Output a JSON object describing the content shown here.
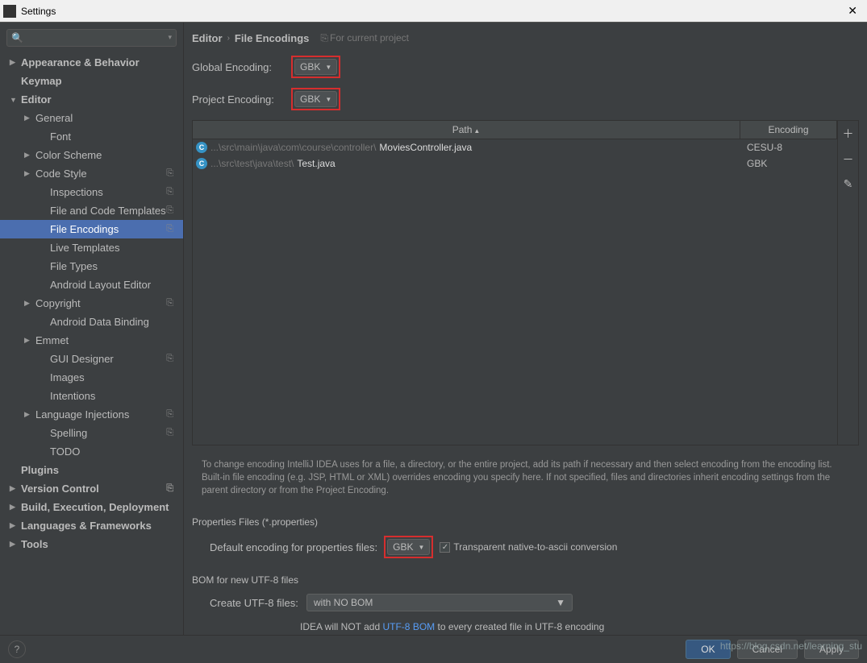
{
  "window": {
    "title": "Settings"
  },
  "search": {
    "placeholder": ""
  },
  "sidebar": {
    "items": [
      {
        "label": "Appearance & Behavior",
        "indent": 0,
        "arrow": "▶",
        "bold": true
      },
      {
        "label": "Keymap",
        "indent": 0,
        "arrow": "",
        "bold": true
      },
      {
        "label": "Editor",
        "indent": 0,
        "arrow": "▼",
        "bold": true
      },
      {
        "label": "General",
        "indent": 1,
        "arrow": "▶"
      },
      {
        "label": "Font",
        "indent": 2,
        "arrow": ""
      },
      {
        "label": "Color Scheme",
        "indent": 1,
        "arrow": "▶"
      },
      {
        "label": "Code Style",
        "indent": 1,
        "arrow": "▶",
        "copy": true
      },
      {
        "label": "Inspections",
        "indent": 2,
        "arrow": "",
        "copy": true
      },
      {
        "label": "File and Code Templates",
        "indent": 2,
        "arrow": "",
        "copy": true
      },
      {
        "label": "File Encodings",
        "indent": 2,
        "arrow": "",
        "copy": true,
        "selected": true
      },
      {
        "label": "Live Templates",
        "indent": 2,
        "arrow": ""
      },
      {
        "label": "File Types",
        "indent": 2,
        "arrow": ""
      },
      {
        "label": "Android Layout Editor",
        "indent": 2,
        "arrow": ""
      },
      {
        "label": "Copyright",
        "indent": 1,
        "arrow": "▶",
        "copy": true
      },
      {
        "label": "Android Data Binding",
        "indent": 2,
        "arrow": ""
      },
      {
        "label": "Emmet",
        "indent": 1,
        "arrow": "▶"
      },
      {
        "label": "GUI Designer",
        "indent": 2,
        "arrow": "",
        "copy": true
      },
      {
        "label": "Images",
        "indent": 2,
        "arrow": ""
      },
      {
        "label": "Intentions",
        "indent": 2,
        "arrow": ""
      },
      {
        "label": "Language Injections",
        "indent": 1,
        "arrow": "▶",
        "copy": true
      },
      {
        "label": "Spelling",
        "indent": 2,
        "arrow": "",
        "copy": true
      },
      {
        "label": "TODO",
        "indent": 2,
        "arrow": ""
      },
      {
        "label": "Plugins",
        "indent": 0,
        "arrow": "",
        "bold": true
      },
      {
        "label": "Version Control",
        "indent": 0,
        "arrow": "▶",
        "bold": true,
        "copy": true
      },
      {
        "label": "Build, Execution, Deployment",
        "indent": 0,
        "arrow": "▶",
        "bold": true
      },
      {
        "label": "Languages & Frameworks",
        "indent": 0,
        "arrow": "▶",
        "bold": true
      },
      {
        "label": "Tools",
        "indent": 0,
        "arrow": "▶",
        "bold": true
      }
    ]
  },
  "breadcrumb": {
    "part1": "Editor",
    "part2": "File Encodings",
    "note": "For current project"
  },
  "globalEncoding": {
    "label": "Global Encoding:",
    "value": "GBK"
  },
  "projectEncoding": {
    "label": "Project Encoding:",
    "value": "GBK"
  },
  "table": {
    "headers": {
      "path": "Path",
      "encoding": "Encoding"
    },
    "rows": [
      {
        "pathGray": "...\\src\\main\\java\\com\\course\\controller\\",
        "pathWhite": "MoviesController.java",
        "encoding": "CESU-8"
      },
      {
        "pathGray": "...\\src\\test\\java\\test\\",
        "pathWhite": "Test.java",
        "encoding": "GBK"
      }
    ]
  },
  "hint": "To change encoding IntelliJ IDEA uses for a file, a directory, or the entire project, add its path if necessary and then select encoding from the encoding list. Built-in file encoding (e.g. JSP, HTML or XML) overrides encoding you specify here. If not specified, files and directories inherit encoding settings from the parent directory or from the Project Encoding.",
  "propertiesSection": {
    "title": "Properties Files (*.properties)",
    "defaultLabel": "Default encoding for properties files:",
    "defaultValue": "GBK",
    "checkboxLabel": "Transparent native-to-ascii conversion"
  },
  "bomSection": {
    "title": "BOM for new UTF-8 files",
    "createLabel": "Create UTF-8 files:",
    "createValue": "with NO BOM",
    "noteBefore": "IDEA will NOT add ",
    "noteLink": "UTF-8 BOM",
    "noteAfter": " to every created file in UTF-8 encoding"
  },
  "buttons": {
    "ok": "OK",
    "cancel": "Cancel",
    "apply": "Apply"
  },
  "watermark": "https://blog.csdn.net/learning_stu"
}
